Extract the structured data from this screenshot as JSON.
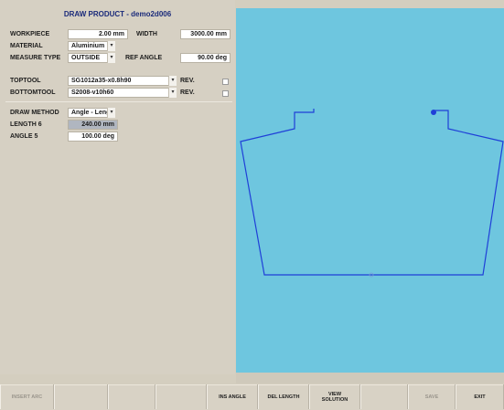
{
  "window_title": "DRAW PRODUCT - demo2d006",
  "form": {
    "workpiece_label": "WORKPIECE",
    "workpiece_value": "2.00 mm",
    "width_label": "WIDTH",
    "width_value": "3000.00 mm",
    "material_label": "MATERIAL",
    "material_value": "Aluminium",
    "measure_type_label": "MEASURE TYPE",
    "measure_type_value": "OUTSIDE",
    "ref_angle_label": "REF ANGLE",
    "ref_angle_value": "90.00 deg",
    "toptool_label": "TOPTOOL",
    "toptool_value": "SG1012a35-x0.8h90",
    "toptool_rev_label": "REV.",
    "bottomtool_label": "BOTTOMTOOL",
    "bottomtool_value": "S2008-v10h60",
    "bottomtool_rev_label": "REV.",
    "draw_method_label": "DRAW METHOD",
    "draw_method_value": "Angle - Lengt",
    "length_label": "LENGTH 6",
    "length_value": "240.00 mm",
    "angle_label": "ANGLE 5",
    "angle_value": "100.00 deg"
  },
  "toolbar": {
    "buttons": [
      {
        "label": "INSERT ARC",
        "enabled": false
      },
      {
        "label": "",
        "enabled": true
      },
      {
        "label": "",
        "enabled": true
      },
      {
        "label": "",
        "enabled": true
      },
      {
        "label": "INS ANGLE",
        "enabled": true
      },
      {
        "label": "DEL LENGTH",
        "enabled": true
      },
      {
        "label": "VIEW\nSOLUTION",
        "enabled": true
      },
      {
        "label": "",
        "enabled": true
      },
      {
        "label": "SAVE",
        "enabled": false
      },
      {
        "label": "EXIT",
        "enabled": true
      }
    ]
  },
  "colors": {
    "canvas_bg": "#6ec6df",
    "profile_line": "#1f3fd8",
    "title_text": "#1a2a7a"
  },
  "icons": {
    "dropdown": "chevron-down-icon",
    "selected_point": "selected-vertex-icon",
    "midpoint": "midpoint-marker-icon"
  }
}
